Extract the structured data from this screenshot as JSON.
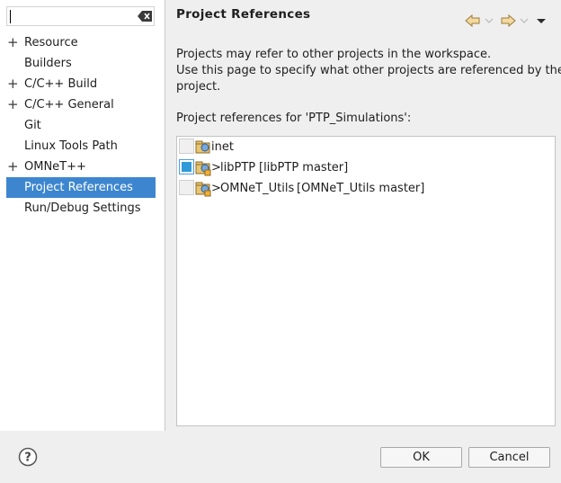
{
  "sidebar": {
    "filter": {
      "value": "",
      "placeholder": ""
    },
    "items": [
      {
        "label": "Resource",
        "expandable": true
      },
      {
        "label": "Builders",
        "expandable": false
      },
      {
        "label": "C/C++ Build",
        "expandable": true
      },
      {
        "label": "C/C++ General",
        "expandable": true
      },
      {
        "label": "Git",
        "expandable": false
      },
      {
        "label": "Linux Tools Path",
        "expandable": false
      },
      {
        "label": "OMNeT++",
        "expandable": true
      },
      {
        "label": "Project References",
        "expandable": false,
        "selected": true
      },
      {
        "label": "Run/Debug Settings",
        "expandable": false
      }
    ]
  },
  "main": {
    "title": "Project References",
    "description_line1": "Projects may refer to other projects in the workspace.",
    "description_line2": "Use this page to specify what other projects are referenced by the",
    "description_line3": "project.",
    "references_label": "Project references for 'PTP_Simulations':",
    "references": [
      {
        "name": "inet",
        "prefix": "",
        "repo": "",
        "checked": false
      },
      {
        "name": "libPTP",
        "prefix": ">",
        "repo": "[libPTP master]",
        "checked": true
      },
      {
        "name": "OMNeT_Utils",
        "prefix": ">",
        "repo": "[OMNeT_Utils master]",
        "checked": false
      }
    ]
  },
  "buttons": {
    "ok": "OK",
    "cancel": "Cancel"
  },
  "icons": {
    "back": "arrow-left-icon",
    "forward": "arrow-right-icon",
    "menu": "dropdown-triangle-icon",
    "help": "help-icon",
    "clear": "clear-filter-icon"
  },
  "colors": {
    "selection": "#3d86cf",
    "checkbox_fill": "#2f9ad8"
  }
}
